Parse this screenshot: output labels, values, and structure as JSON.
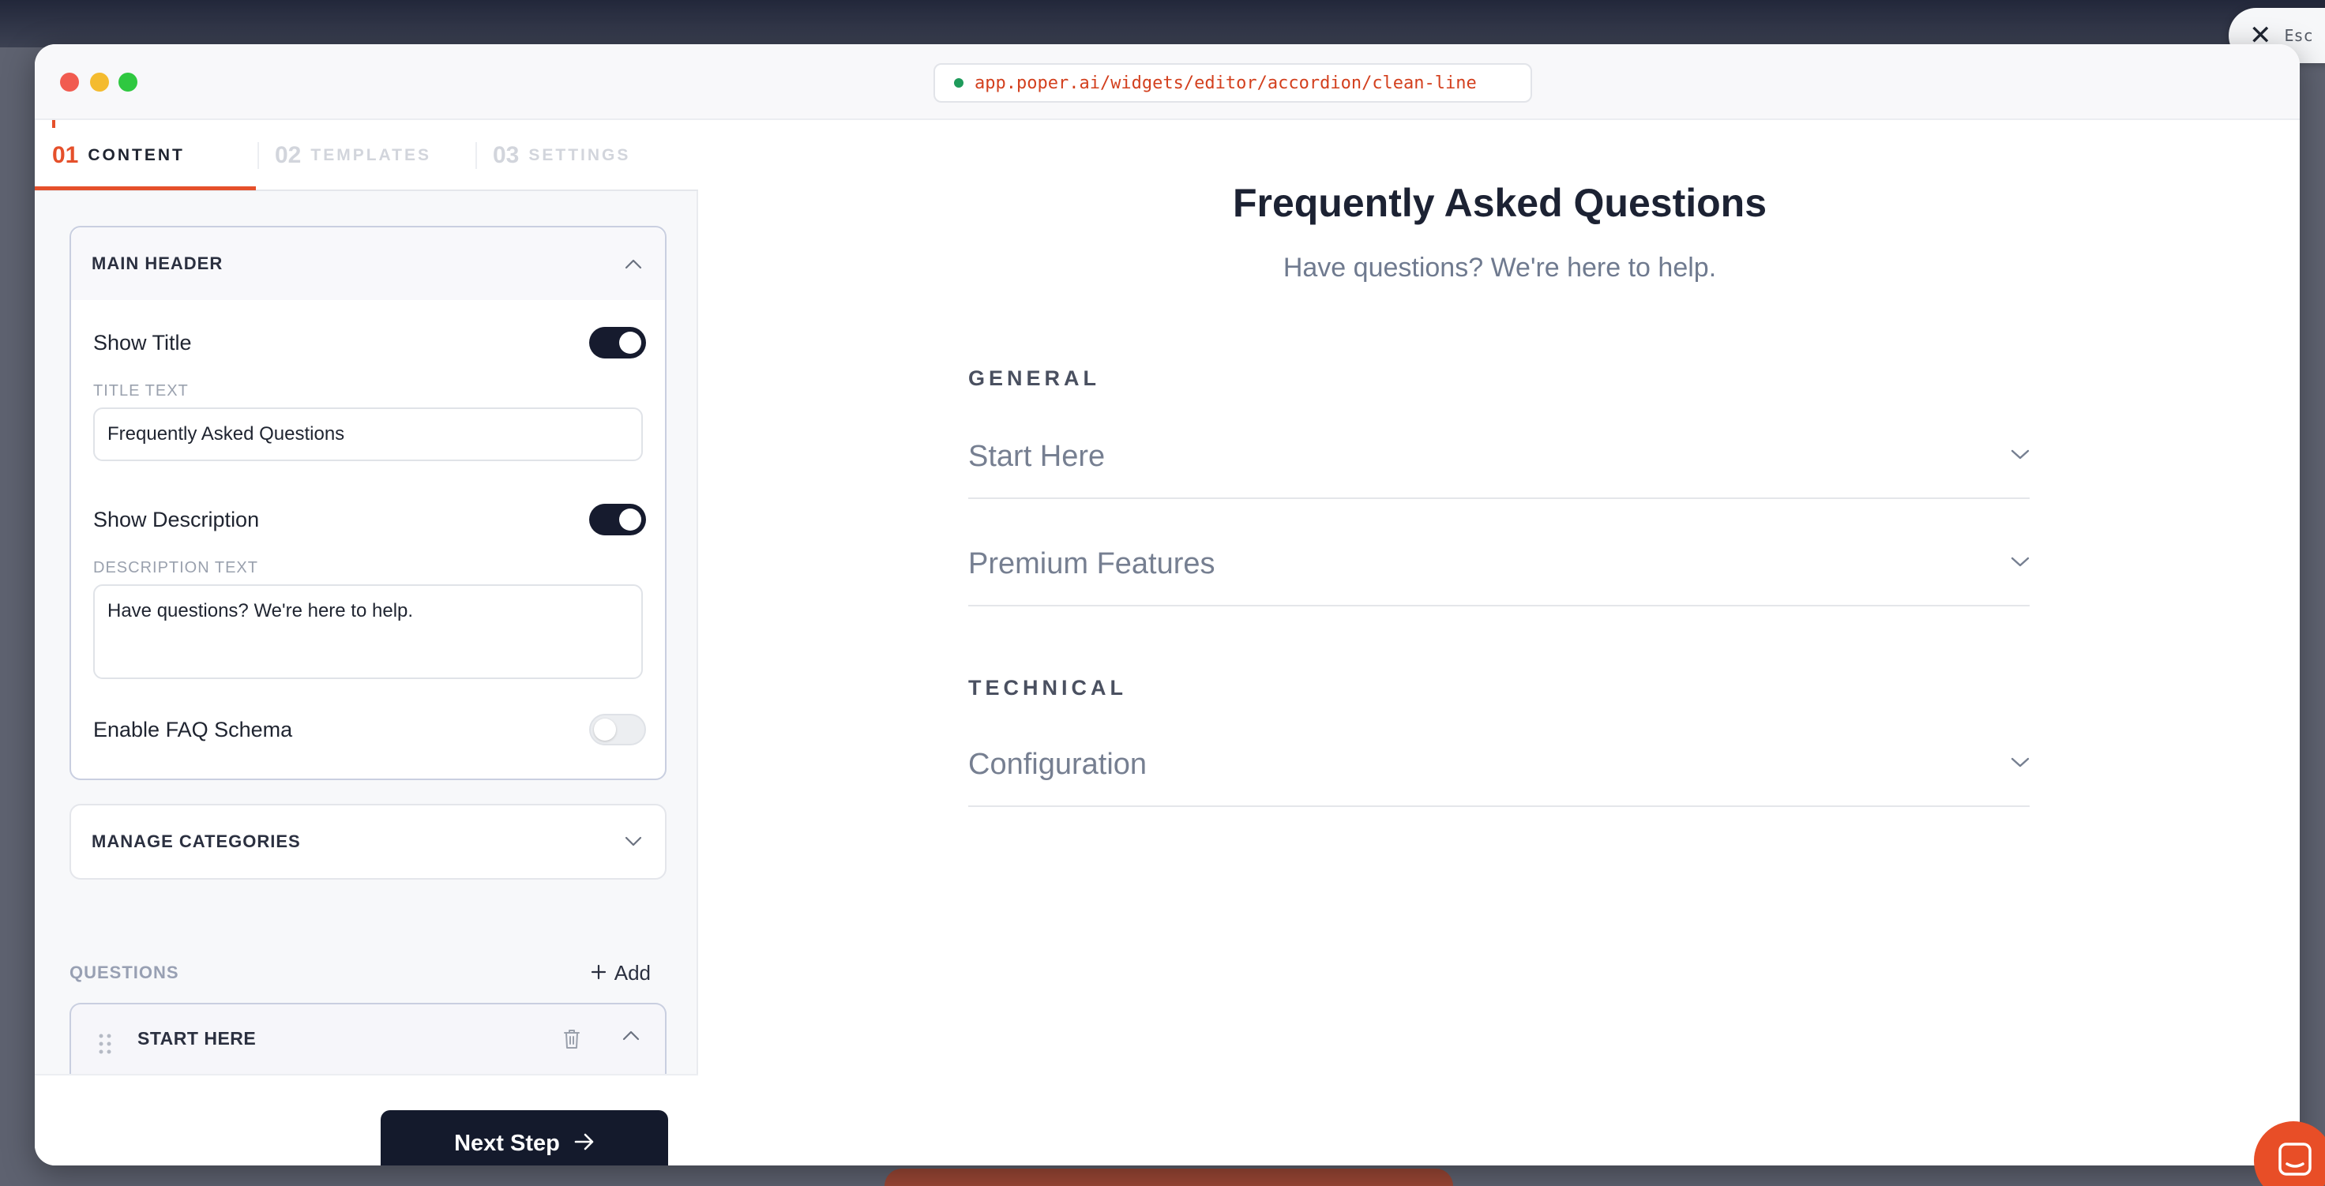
{
  "browser": {
    "url": "app.poper.ai/widgets/editor/accordion/clean-line",
    "esc_label": "Esc"
  },
  "tabs": [
    {
      "num": "01",
      "label": "CONTENT",
      "active": true
    },
    {
      "num": "02",
      "label": "TEMPLATES",
      "active": false
    },
    {
      "num": "03",
      "label": "SETTINGS",
      "active": false
    }
  ],
  "main_header": {
    "title": "MAIN HEADER",
    "show_title_label": "Show Title",
    "show_title_on": true,
    "title_text_label": "TITLE TEXT",
    "title_text_value": "Frequently Asked Questions",
    "show_description_label": "Show Description",
    "show_description_on": true,
    "description_text_label": "DESCRIPTION TEXT",
    "description_text_value": "Have questions? We're here to help.",
    "faq_schema_label": "Enable FAQ Schema",
    "faq_schema_on": false
  },
  "manage_categories": {
    "title": "MANAGE CATEGORIES"
  },
  "questions": {
    "label": "QUESTIONS",
    "add_label": "Add",
    "items": [
      {
        "title": "START HERE"
      }
    ]
  },
  "footer": {
    "next_label": "Next Step"
  },
  "preview": {
    "title": "Frequently Asked Questions",
    "description": "Have questions? We're here to help.",
    "categories": [
      {
        "name": "GENERAL",
        "items": [
          "Start Here",
          "Premium Features"
        ]
      },
      {
        "name": "TECHNICAL",
        "items": [
          "Configuration"
        ]
      }
    ]
  },
  "colors": {
    "accent": "#e5502b",
    "primary_dark": "#141a2c",
    "url_text": "#d3401e"
  },
  "icons": [
    "close-icon",
    "chevron-up-icon",
    "chevron-down-icon",
    "plus-icon",
    "drag-handle-icon",
    "trash-icon",
    "arrow-right-icon",
    "chat-icon"
  ]
}
